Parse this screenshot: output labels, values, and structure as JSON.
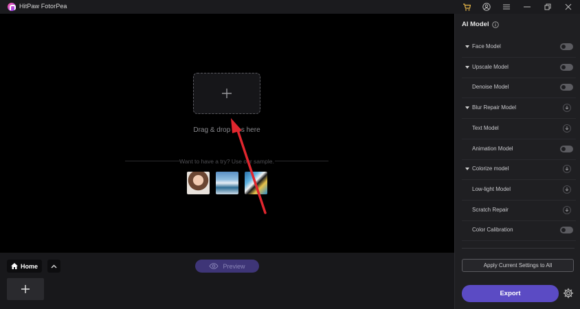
{
  "app": {
    "title": "HitPaw FotorPea"
  },
  "titlebar": {
    "icons": [
      "cart-icon",
      "account-icon",
      "menu-icon",
      "minimize-icon",
      "restore-icon",
      "close-icon"
    ]
  },
  "canvas": {
    "drop_text": "Drag & drop files here",
    "sample_prompt": "Want to have a try? Use our sample.",
    "samples": [
      "portrait-sample",
      "landscape-sample",
      "parrot-sample"
    ]
  },
  "bottom": {
    "home_label": "Home",
    "preview_label": "Preview"
  },
  "panel": {
    "title": "AI Model",
    "models": [
      {
        "label": "Face Model",
        "control": "toggle",
        "expandable": true
      },
      {
        "label": "Upscale Model",
        "control": "toggle",
        "expandable": true
      },
      {
        "label": "Denoise Model",
        "control": "toggle",
        "expandable": false
      },
      {
        "label": "Blur Repair Model",
        "control": "download",
        "expandable": true
      },
      {
        "label": "Text Model",
        "control": "download",
        "expandable": false
      },
      {
        "label": "Animation Model",
        "control": "toggle",
        "expandable": false
      },
      {
        "label": "Colorize model",
        "control": "download",
        "expandable": true
      },
      {
        "label": "Low-light Model",
        "control": "download",
        "expandable": false
      },
      {
        "label": "Scratch Repair",
        "control": "download",
        "expandable": false
      },
      {
        "label": "Color Calibration",
        "control": "toggle",
        "expandable": false
      }
    ],
    "apply_label": "Apply Current Settings to All",
    "export_label": "Export"
  },
  "colors": {
    "accent": "#5b4bc4",
    "preview_bg": "#3e3577",
    "arrow": "#e0262e",
    "panel_bg": "#1f1f22"
  }
}
